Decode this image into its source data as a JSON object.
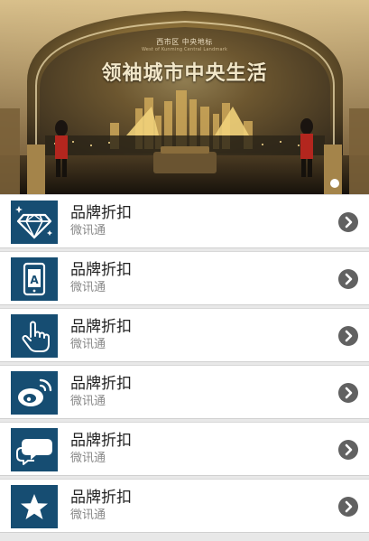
{
  "banner": {
    "subtitle_cn": "西市区 中央地标",
    "subtitle_en": "West of Kunming  Central Landmark",
    "title": "领袖城市中央生活",
    "slides_total": 1,
    "active_slide": 1
  },
  "list": {
    "items": [
      {
        "title": "品牌折扣",
        "subtitle": "微讯通",
        "icon": "diamond-icon"
      },
      {
        "title": "品牌折扣",
        "subtitle": "微讯通",
        "icon": "tablet-icon"
      },
      {
        "title": "品牌折扣",
        "subtitle": "微讯通",
        "icon": "pointing-hand-icon"
      },
      {
        "title": "品牌折扣",
        "subtitle": "微讯通",
        "icon": "weibo-icon"
      },
      {
        "title": "品牌折扣",
        "subtitle": "微讯通",
        "icon": "chat-bubbles-icon"
      },
      {
        "title": "品牌折扣",
        "subtitle": "微讯通",
        "icon": "star-icon"
      }
    ]
  },
  "colors": {
    "icon_tile": "#164d72",
    "chevron": "#616161",
    "title_text": "#222222",
    "subtitle_text": "#888888",
    "page_background": "#e8e8e8"
  }
}
